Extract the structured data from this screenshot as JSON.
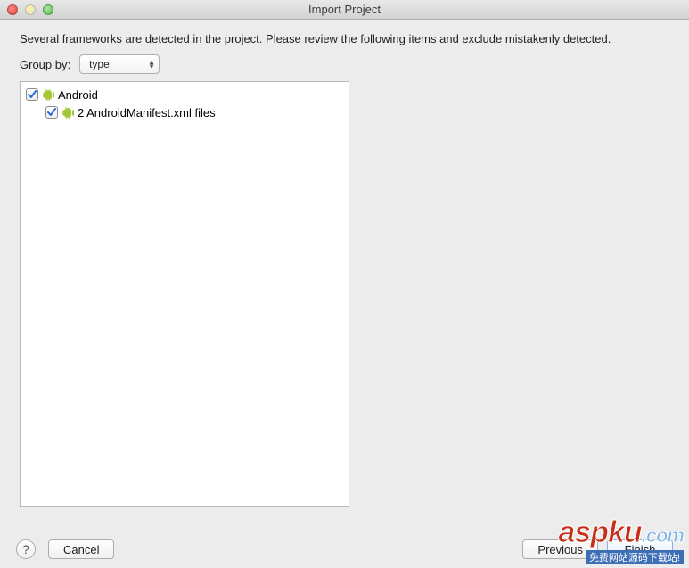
{
  "window": {
    "title": "Import Project"
  },
  "description": "Several frameworks are detected in the project. Please review the following items and exclude mistakenly detected.",
  "groupBy": {
    "label": "Group by:",
    "selected": "type"
  },
  "tree": {
    "items": [
      {
        "label": "Android",
        "checked": true,
        "icon": "android-icon"
      },
      {
        "label": "2 AndroidManifest.xml files",
        "checked": true,
        "icon": "android-icon",
        "child": true
      }
    ]
  },
  "buttons": {
    "help": "?",
    "cancel": "Cancel",
    "previous": "Previous",
    "finish": "Finish"
  },
  "watermark": {
    "brand": "aspku",
    "suffix": ".com",
    "tagline": "免费网站源码下载站!"
  }
}
